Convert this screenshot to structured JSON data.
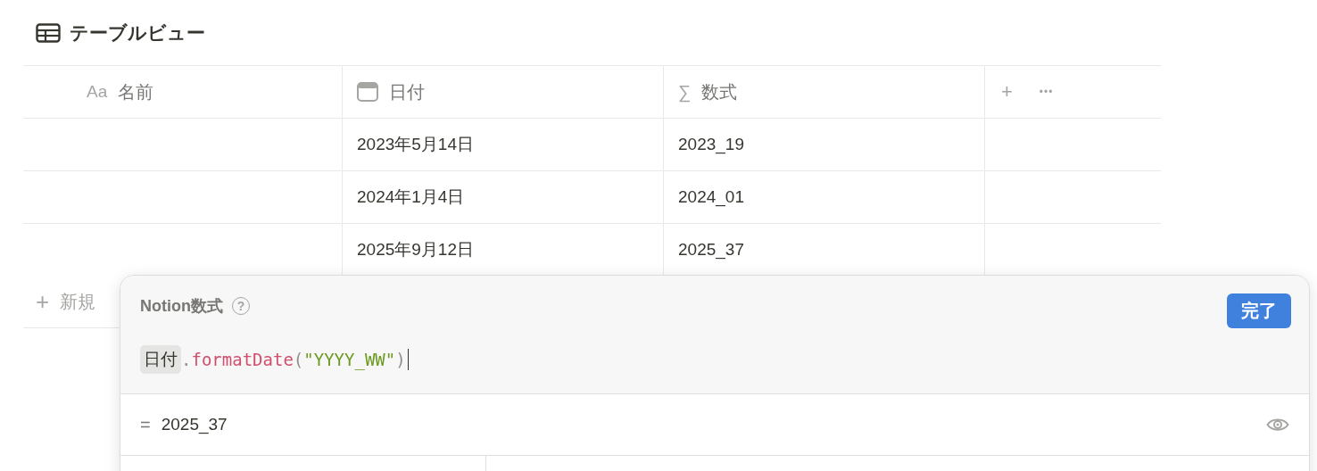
{
  "view": {
    "title": "テーブルビュー"
  },
  "table": {
    "columns": [
      {
        "kind": "title",
        "icon_text": "Aa",
        "label": "名前"
      },
      {
        "kind": "date",
        "label": "日付"
      },
      {
        "kind": "formula",
        "icon_text": "∑",
        "label": "数式"
      }
    ],
    "rows": [
      {
        "cells": [
          "",
          "2023年5月14日",
          "2023_19"
        ]
      },
      {
        "cells": [
          "",
          "2024年1月4日",
          "2024_01"
        ]
      },
      {
        "cells": [
          "",
          "2025年9月12日",
          "2025_37"
        ]
      }
    ],
    "add_column": "+",
    "more": "•••",
    "new_row": {
      "icon": "+",
      "label": "新規"
    }
  },
  "formula_editor": {
    "title": "Notion数式",
    "help": "?",
    "done_button": "完了",
    "tokens": [
      {
        "kind": "property",
        "text": "日付"
      },
      {
        "kind": "punct",
        "text": "."
      },
      {
        "kind": "function",
        "text": "formatDate"
      },
      {
        "kind": "punct",
        "text": "("
      },
      {
        "kind": "string",
        "text": "\"YYYY_WW\""
      },
      {
        "kind": "punct",
        "text": ")"
      }
    ],
    "focused": true,
    "result_sign": "=",
    "result": "2025_37"
  }
}
